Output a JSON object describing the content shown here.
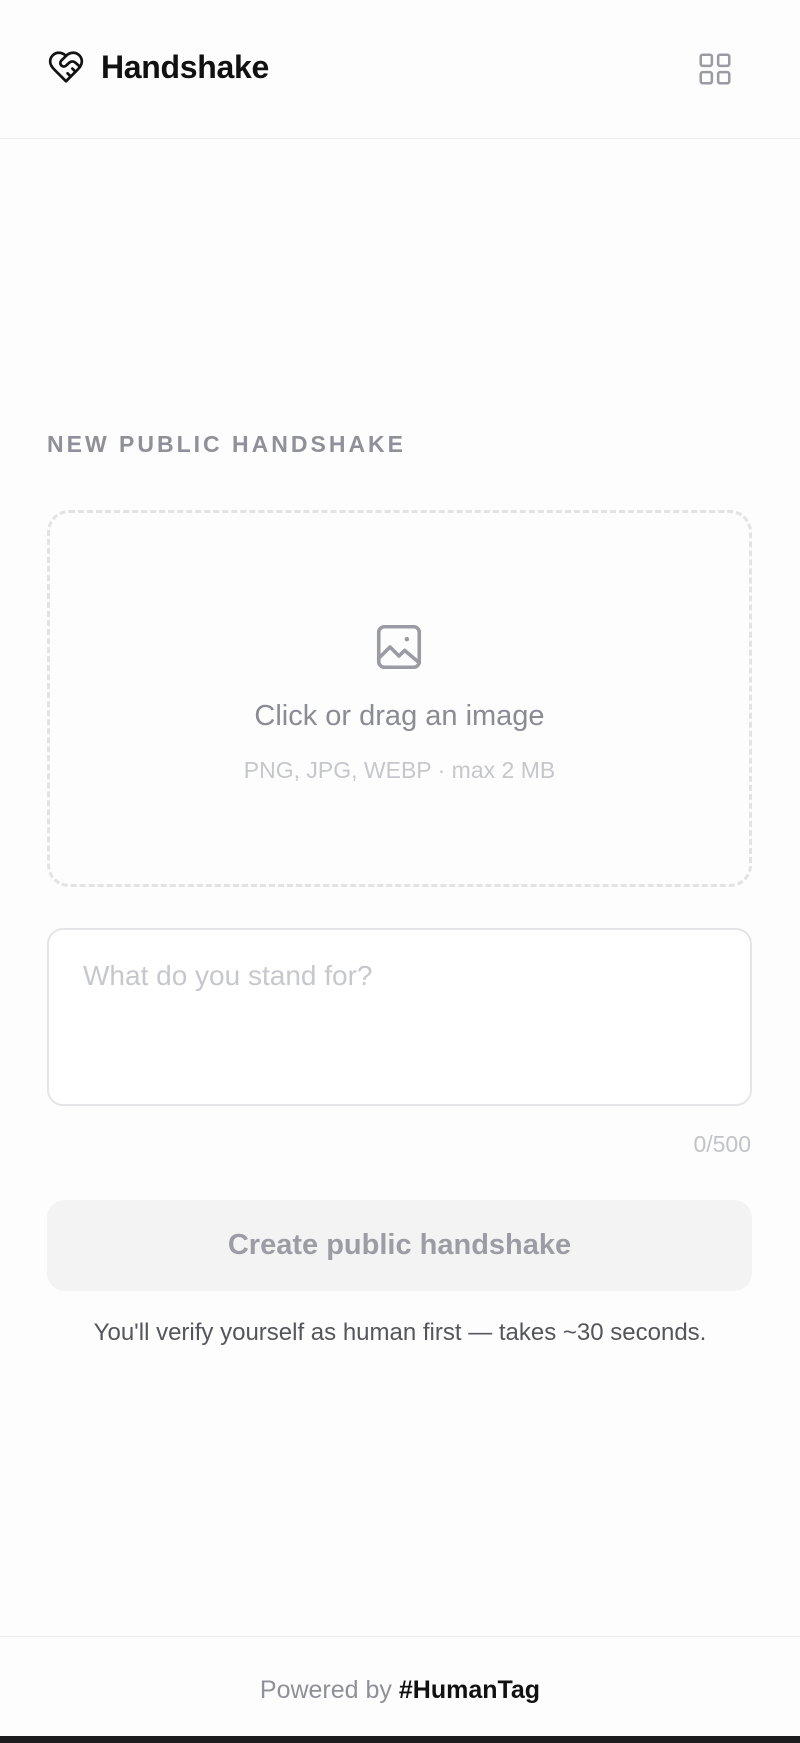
{
  "header": {
    "brand_name": "Handshake",
    "logo_icon": "heart-handshake-icon",
    "apps_icon": "grid-icon"
  },
  "form": {
    "section_title": "NEW PUBLIC HANDSHAKE",
    "dropzone": {
      "icon": "image-icon",
      "title": "Click or drag an image",
      "hint": "PNG, JPG, WEBP · max 2 MB"
    },
    "statement": {
      "value": "",
      "placeholder": "What do you stand for?",
      "counter": "0/500"
    },
    "submit_label": "Create public handshake",
    "verify_note": "You'll verify yourself as human first — takes ~30 seconds."
  },
  "footer": {
    "prefix": "Powered by ",
    "link_text": "#HumanTag"
  },
  "colors": {
    "muted_text": "#8f9099",
    "button_bg": "#f3f3f4",
    "dashed_border": "#e3e3e6"
  }
}
